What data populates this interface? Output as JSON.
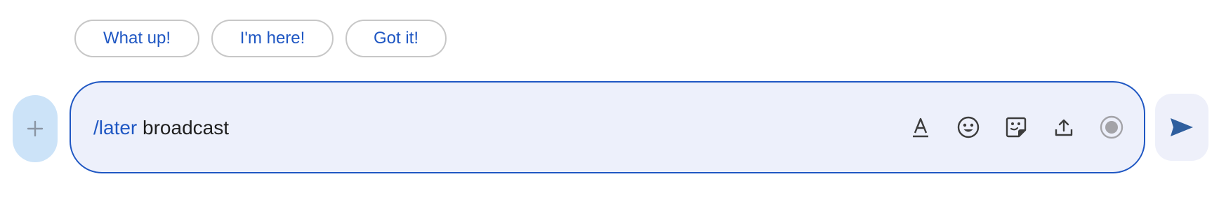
{
  "suggestions": [
    {
      "label": "What up!"
    },
    {
      "label": "I'm here!"
    },
    {
      "label": "Got it!"
    }
  ],
  "composer": {
    "command": "/later",
    "argument": "broadcast"
  },
  "icons": {
    "add": "plus-icon",
    "format": "format-text-icon",
    "emoji": "emoji-smile-icon",
    "sticker": "sticker-icon",
    "upload": "upload-icon",
    "record": "record-icon",
    "send": "send-arrow-icon"
  },
  "colors": {
    "accent": "#1f57c3",
    "composer_bg": "#edf0fb",
    "add_button_bg": "#cce3f8",
    "send_icon": "#2f5f9e"
  }
}
